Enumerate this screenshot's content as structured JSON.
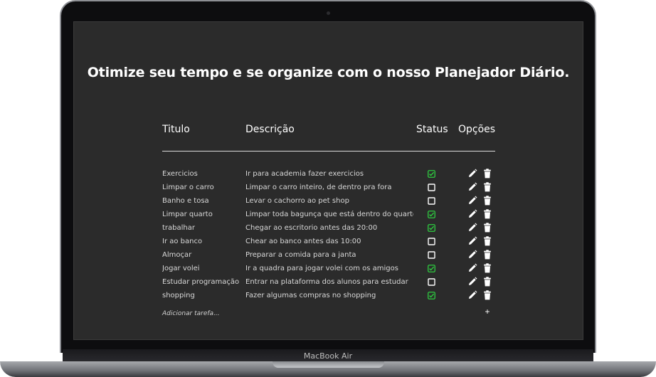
{
  "headline": "Otimize seu tempo e se organize com o nosso Planejador Diário.",
  "columns": {
    "title": "Titulo",
    "description": "Descrição",
    "status": "Status",
    "options": "Opções"
  },
  "tasks": [
    {
      "title": "Exercicios",
      "description": "Ir para academia fazer exercicios",
      "done": true
    },
    {
      "title": "Limpar o carro",
      "description": "Limpar o carro inteiro, de dentro pra fora",
      "done": false
    },
    {
      "title": "Banho e tosa",
      "description": "Levar o cachorro ao pet shop",
      "done": false
    },
    {
      "title": "Limpar quarto",
      "description": "Limpar toda bagunça que está dentro do quarto",
      "done": true
    },
    {
      "title": "trabalhar",
      "description": "Chegar ao escritorio antes das 20:00",
      "done": true
    },
    {
      "title": "Ir ao banco",
      "description": "Chear ao banco antes das 10:00",
      "done": false
    },
    {
      "title": "Almoçar",
      "description": "Preparar a comida para a janta",
      "done": false
    },
    {
      "title": "Jogar volei",
      "description": "Ir a quadra para jogar volei com os amigos",
      "done": true
    },
    {
      "title": "Estudar programação",
      "description": "Entrar na plataforma dos alunos para estudar",
      "done": false
    },
    {
      "title": "shopping",
      "description": "Fazer algumas compras no shopping",
      "done": true
    }
  ],
  "add_task": {
    "placeholder": "Adicionar tarefa...",
    "button_glyph": "+"
  },
  "device_label": "MacBook Air",
  "icons": {
    "edit": "pencil-icon",
    "delete": "trash-icon",
    "checked": "checkbox-checked-icon",
    "unchecked": "checkbox-empty-icon"
  },
  "colors": {
    "screen_bg": "#2b2b2b",
    "checked": "#2ecc40",
    "text": "#ffffff"
  }
}
